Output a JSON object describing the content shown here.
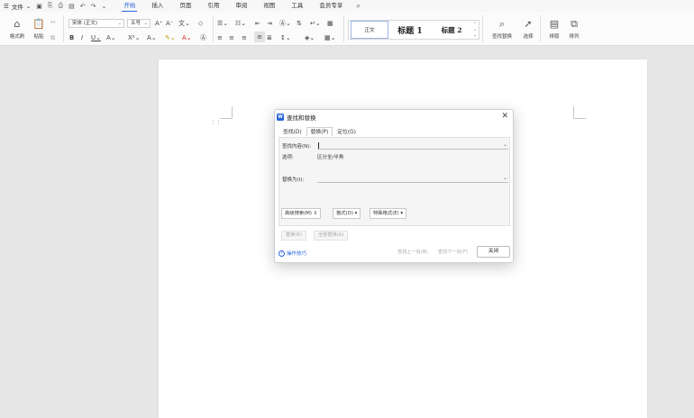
{
  "menubar": {
    "file_label": "文件",
    "tabs": [
      "开始",
      "插入",
      "页面",
      "引用",
      "审阅",
      "视图",
      "工具",
      "会员专享"
    ],
    "active_tab": "开始"
  },
  "ribbon": {
    "format_painter": "格式刷",
    "paste": "粘贴",
    "font_name": "宋体 (正文)",
    "font_size": "五号",
    "styles": {
      "normal": "正文",
      "heading1": "标题 1",
      "heading2": "标题 2"
    },
    "find_replace": "查找替换",
    "select": "选择",
    "layout": "排版",
    "arrange": "排列"
  },
  "dialog": {
    "title": "查找和替换",
    "tabs": [
      "查找(D)",
      "替换(P)",
      "定位(G)"
    ],
    "active_tab": "替换(P)",
    "find_label": "查找内容(N):",
    "find_value": "",
    "options_label": "选项:",
    "options_value": "区分全/半角",
    "replace_label": "替换为(I):",
    "replace_value": "",
    "advanced_search": "高级搜索(M)",
    "format": "格式(O)",
    "special_format": "特殊格式(E)",
    "replace_btn": "替换(R)",
    "replace_all_btn": "全部替换(A)",
    "tips": "操作技巧",
    "find_prev": "查找上一处(B)",
    "find_next": "查找下一处(F)",
    "close": "关闭"
  },
  "colors": {
    "accent": "#2b66d8"
  },
  "icons": [
    "menu-icon",
    "save-icon",
    "undo-icon",
    "redo-icon",
    "search-icon",
    "format-painter-icon",
    "paste-icon",
    "close-icon",
    "help-icon"
  ]
}
